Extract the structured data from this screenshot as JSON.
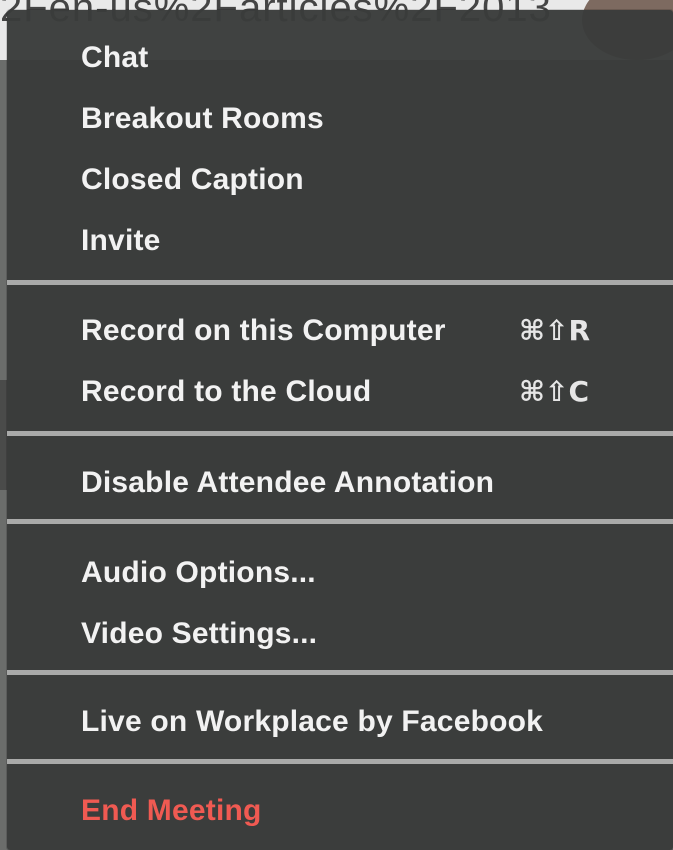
{
  "background": {
    "url_fragment": "2Fen-us%2Farticles%2F2013"
  },
  "menu": {
    "groups": [
      {
        "items": [
          {
            "label": "Chat"
          },
          {
            "label": "Breakout Rooms"
          },
          {
            "label": "Closed Caption"
          },
          {
            "label": "Invite"
          }
        ]
      },
      {
        "items": [
          {
            "label": "Record on this Computer",
            "shortcut": "⌘⇧R"
          },
          {
            "label": "Record to the Cloud",
            "shortcut": "⌘⇧C"
          }
        ]
      },
      {
        "items": [
          {
            "label": "Disable Attendee Annotation"
          }
        ]
      },
      {
        "items": [
          {
            "label": "Audio Options..."
          },
          {
            "label": "Video Settings..."
          }
        ]
      },
      {
        "items": [
          {
            "label": "Live on Workplace by Facebook"
          }
        ]
      },
      {
        "items": [
          {
            "label": "End Meeting",
            "style": "danger"
          }
        ]
      }
    ]
  },
  "colors": {
    "menu_background": "#3a3c3b",
    "menu_text": "#f2f2f2",
    "separator": "#a9aaa9",
    "danger_text": "#f05a52"
  }
}
